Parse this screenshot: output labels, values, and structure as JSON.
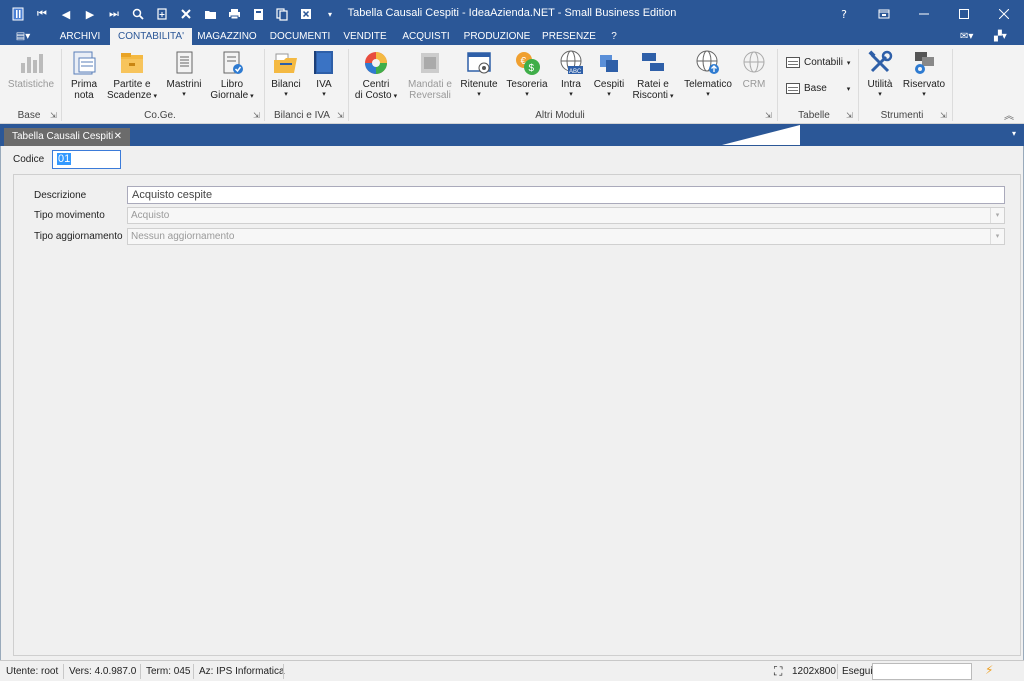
{
  "window": {
    "title": "Tabella Causali Cespiti - IdeaAzienda.NET - Small Business Edition",
    "help": "?",
    "restore": "⧉",
    "minimize": "—",
    "maximize": "☐",
    "close": "✕"
  },
  "quick_access": {
    "first": "⏮",
    "prev": "◀",
    "next": "▶",
    "last": "⏭",
    "search": "🔍",
    "new": "🗋",
    "delete": "✕",
    "open": "📂",
    "print": "🖶",
    "calc": "🗐",
    "copy": "⧉",
    "excel": "X",
    "more": "▾"
  },
  "menu": {
    "app_button": "▤▾",
    "tabs": [
      "ARCHIVI",
      "CONTABILITA'",
      "MAGAZZINO",
      "DOCUMENTI",
      "VENDITE",
      "ACQUISTI",
      "PRODUZIONE",
      "PRESENZE",
      "?"
    ],
    "active_tab": "CONTABILITA'",
    "mail": "✉▾",
    "layout": "▞▾"
  },
  "ribbon": {
    "statistiche": "Statistiche",
    "prima_nota_1": "Prima",
    "prima_nota_2": "nota",
    "partite_1": "Partite e",
    "partite_2": "Scadenze",
    "mastrini": "Mastrini",
    "libro_1": "Libro",
    "libro_2": "Giornale",
    "bilanci": "Bilanci",
    "iva": "IVA",
    "centri_1": "Centri",
    "centri_2": "di Costo",
    "mandati_1": "Mandati e",
    "mandati_2": "Reversali",
    "ritenute": "Ritenute",
    "tesoreria": "Tesoreria",
    "intra": "Intra",
    "cespiti": "Cespiti",
    "ratei_1": "Ratei e",
    "ratei_2": "Risconti",
    "telematico": "Telematico",
    "crm": "CRM",
    "contabili": "Contabili",
    "base_small": "Base",
    "utilita": "Utilità",
    "riservato": "Riservato",
    "groups": {
      "base": "Base",
      "coge": "Co.Ge.",
      "bilanci_iva": "Bilanci e IVA",
      "altri": "Altri Moduli",
      "tabelle": "Tabelle",
      "strumenti": "Strumenti"
    },
    "arrow": "▾",
    "launcher": "⇲",
    "collapse": "︽"
  },
  "doc_tab": {
    "label": "Tabella Causali Cespiti",
    "close": "✕",
    "menu": "▾"
  },
  "form": {
    "codice_label": "Codice",
    "codice_value": "01",
    "descrizione_label": "Descrizione",
    "descrizione_value": "Acquisto cespite",
    "tipo_movimento_label": "Tipo movimento",
    "tipo_movimento_value": "Acquisto",
    "tipo_aggiornamento_label": "Tipo aggiornamento",
    "tipo_aggiornamento_value": "Nessun aggiornamento",
    "dropdown": "▾"
  },
  "status": {
    "utente": "Utente: root",
    "versione": "Vers: 4.0.987.0",
    "term": "Term: 045",
    "azienda": "Az: IPS Informatica",
    "resolution": "1202x800",
    "esegui": "Esegui",
    "resize_icon": "⛶",
    "bolt": "⚡"
  },
  "colors": {
    "title_bar": "#2b5797",
    "ribbon_bg": "#f3f3f3",
    "content_bg": "#f0f0f0",
    "doc_tab_bg": "#6b6b6b",
    "focus_border": "#3b7bd9"
  }
}
